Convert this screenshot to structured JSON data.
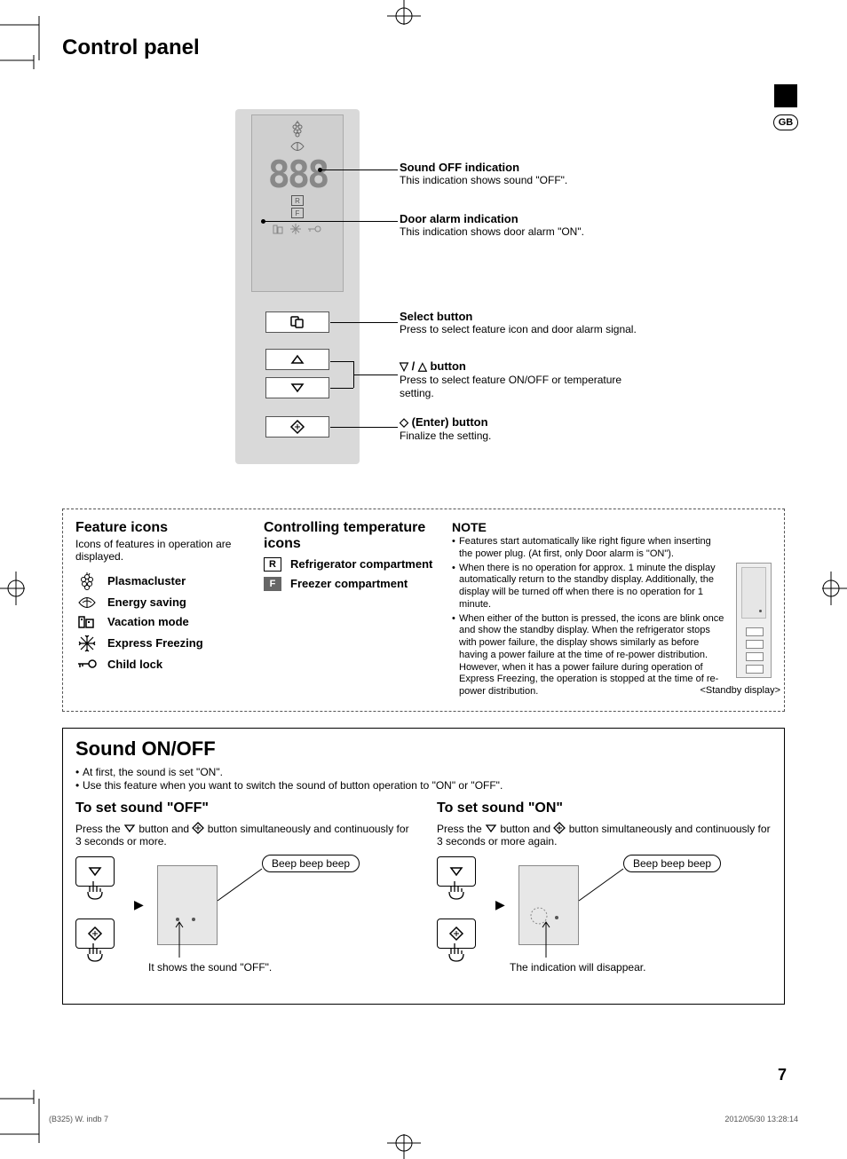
{
  "page": {
    "title": "Control panel",
    "lang_badge": "GB",
    "number": "7"
  },
  "callouts": {
    "sound_off": {
      "title": "Sound OFF indication",
      "desc": "This indication shows sound \"OFF\"."
    },
    "door_alarm": {
      "title": "Door alarm indication",
      "desc": "This indication shows door alarm \"ON\"."
    },
    "select": {
      "title": "Select button",
      "desc": "Press to select feature icon and door alarm signal."
    },
    "updown": {
      "title_prefix": "▽ / △ ",
      "title": "button",
      "desc": "Press to select feature ON/OFF or temperature setting."
    },
    "enter": {
      "title_prefix": "◇ ",
      "title": "(Enter) button",
      "desc": "Finalize the setting."
    }
  },
  "panel": {
    "segments": "888",
    "r_label": "R",
    "f_label": "F"
  },
  "feature_icons": {
    "heading": "Feature icons",
    "desc": "Icons of features in operation are displayed.",
    "items": [
      {
        "label": "Plasmacluster"
      },
      {
        "label": "Energy saving"
      },
      {
        "label": "Vacation mode"
      },
      {
        "label": "Express Freezing"
      },
      {
        "label": "Child lock"
      }
    ]
  },
  "temp_icons": {
    "heading": "Controlling temperature icons",
    "items": [
      {
        "sym": "R",
        "label": "Refrigerator compartment"
      },
      {
        "sym": "F",
        "label": "Freezer compartment"
      }
    ]
  },
  "note": {
    "heading": "NOTE",
    "bullets": [
      "Features start automatically like right figure when inserting the power plug. (At first, only Door alarm is \"ON\").",
      "When there is no operation for approx. 1 minute the display automatically return to the standby display. Additionally, the display will be turned off when there is no operation for 1 minute.",
      "When either of the button is pressed, the icons are blink once and show the standby display. When the refrigerator stops with power failure, the display shows similarly as before having a power failure at the time of re-power distribution. However, when it has a power failure during operation of Express Freezing, the operation is stopped at the time of re-power distribution."
    ],
    "standby_label": "<Standby display>"
  },
  "sound": {
    "heading": "Sound ON/OFF",
    "intro": [
      "At first, the sound is set \"ON\".",
      "Use this feature when you want to switch the sound of button operation to \"ON\" or \"OFF\"."
    ],
    "off": {
      "heading": "To set sound \"OFF\"",
      "text_a": "Press the ",
      "text_b": " button and ",
      "text_c": " button simultaneously and continuously for 3 seconds or more.",
      "beep": "Beep beep beep",
      "caption": "It shows the sound \"OFF\"."
    },
    "on": {
      "heading": "To set sound \"ON\"",
      "text_a": "Press the ",
      "text_b": " button and ",
      "text_c": " button simultaneously and continuously for 3 seconds or more again.",
      "beep": "Beep beep beep",
      "caption": "The indication will disappear."
    }
  },
  "footer": {
    "left": "(B325) W. indb   7",
    "right": "2012/05/30   13:28:14"
  }
}
